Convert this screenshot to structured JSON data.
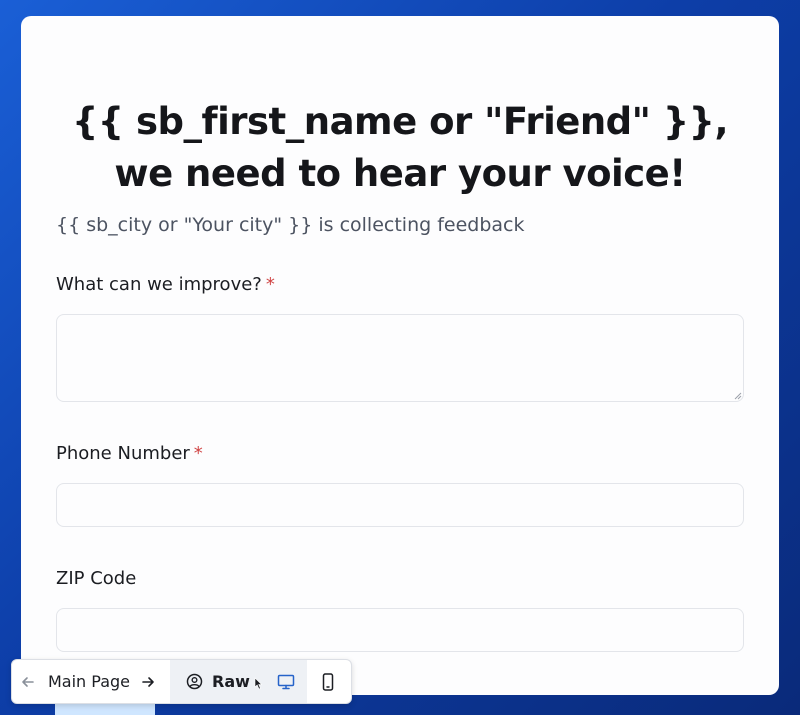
{
  "form": {
    "headline_line1": "{{ sb_first_name or \"Friend\" }},",
    "headline_line2": "we need to hear your voice!",
    "subtitle": "{{ sb_city or \"Your city\" }} is collecting feedback",
    "fields": [
      {
        "label": "What can we improve?",
        "required": true,
        "required_mark": "*",
        "value": "",
        "type": "textarea"
      },
      {
        "label": "Phone Number",
        "required": true,
        "required_mark": "*",
        "value": "",
        "type": "text"
      },
      {
        "label": "ZIP Code",
        "required": false,
        "value": "",
        "type": "text"
      }
    ]
  },
  "toolbar": {
    "page_label": "Main Page",
    "mode_label": "Raw",
    "icons": [
      "arrow-left-icon",
      "arrow-right-icon",
      "user-circle-icon",
      "cursor-icon",
      "desktop-icon",
      "mobile-icon"
    ]
  },
  "colors": {
    "background_gradient_start": "#1a5fd6",
    "background_gradient_end": "#0a2a7a",
    "required_asterisk": "#d04444",
    "desktop_icon_active": "#2563c9"
  }
}
